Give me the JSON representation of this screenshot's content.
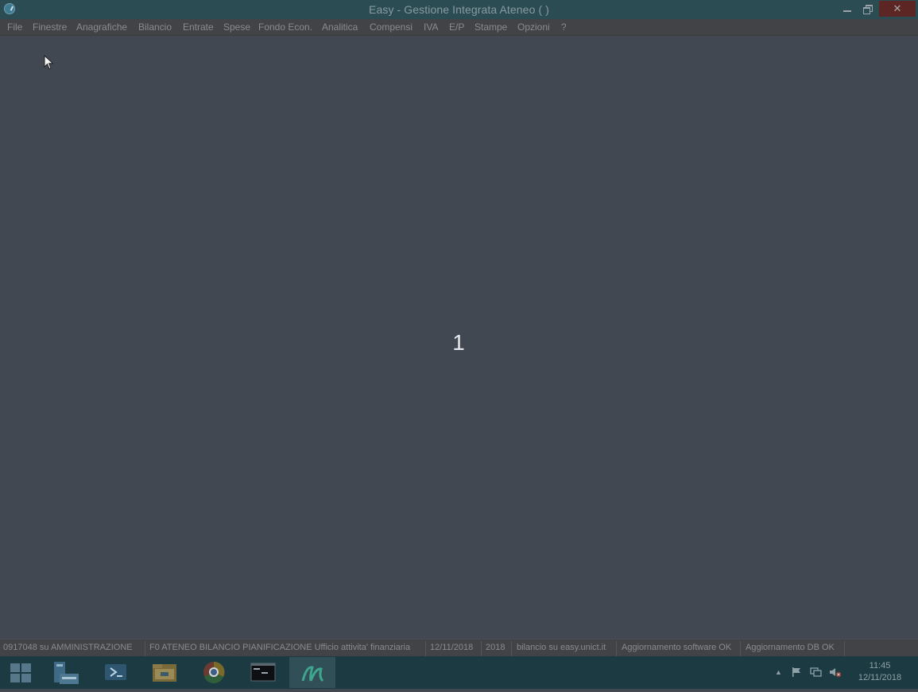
{
  "window": {
    "title": "Easy - Gestione Integrata Ateneo ( )",
    "controls": [
      "minimize",
      "restore",
      "close"
    ]
  },
  "menu": [
    "File",
    "Finestre",
    "Anagrafiche",
    "Bilancio",
    "Entrate",
    "Spese",
    "Fondo Econ.",
    "Analitica",
    "Compensi",
    "IVA",
    "E/P",
    "Stampe",
    "Opzioni",
    "?"
  ],
  "main": {
    "overlay_number": "1"
  },
  "status": {
    "user": "0917048 su AMMINISTRAZIONE",
    "context": "F0 ATENEO BILANCIO PIANIFICAZIONE Ufficio attivita' finanziaria",
    "date": "12/11/2018",
    "year": "2018",
    "server": "bilancio su easy.unict.it",
    "sw_update": "Aggiornamento software OK",
    "db_update": "Aggiornamento DB OK"
  },
  "taskbar": {
    "apps": [
      "start-icon",
      "server-manager-icon",
      "powershell-icon",
      "file-explorer-icon",
      "chrome-icon",
      "command-prompt-icon",
      "easy-app-icon"
    ],
    "clock_time": "11:45",
    "clock_date": "12/11/2018"
  }
}
